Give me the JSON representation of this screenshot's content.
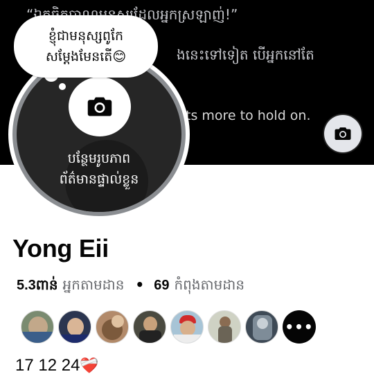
{
  "cover": {
    "line1": "“ឯកចិត្តប្ញាណមនុស្សដែលអ្នកស្រឡាញ់!”",
    "line2": "ងនេះទៅទៀត បើអ្នកនៅតែ",
    "line3": "ts more to hold on.",
    "camera_icon": "camera-icon"
  },
  "avatar": {
    "add_photo_line1": "បន្ថែមរូបភាព",
    "add_photo_line2": "ព័ត៌មានផ្ទាល់ខ្លួន",
    "camera_icon": "camera-icon"
  },
  "bubble": {
    "line1": "ខ្ញុំជាមនុស្សពូកែ",
    "line2": "សម្ដែងមែនតើ",
    "emoji": "😊"
  },
  "profile": {
    "name": "Yong Eii",
    "followers_count": "5.3ពាន់",
    "followers_label": "អ្នកតាមដាន",
    "separator": "•",
    "following_count": "69",
    "following_label": "កំពុងតាមដាន",
    "more_label": "•••",
    "bio": "17 12 24",
    "bio_emoji": "❤️‍🩹"
  },
  "colors": {
    "accent_heart": "#e41e3f",
    "secondary_text": "#65676b",
    "cover_bg": "#000000"
  }
}
